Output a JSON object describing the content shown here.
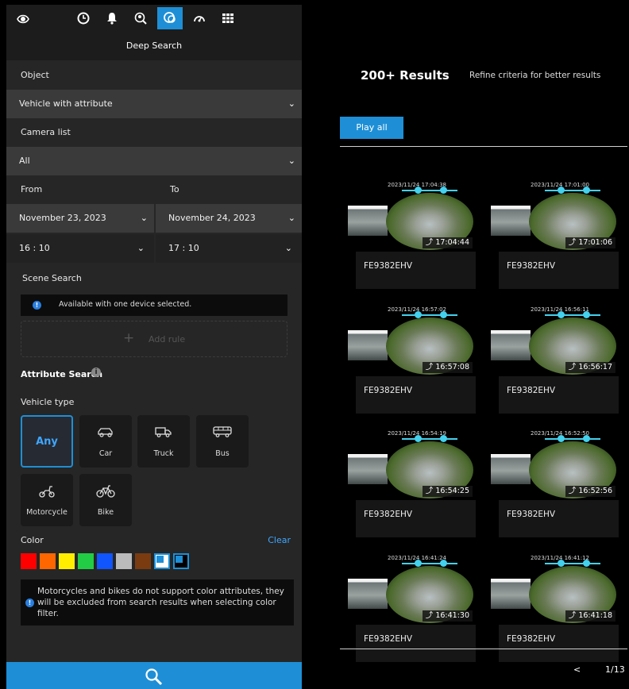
{
  "nav": {
    "icons": [
      "eye-icon",
      "clock-icon",
      "bell-icon",
      "person-search-icon",
      "deep-search-icon",
      "dashboard-icon",
      "grid-icon"
    ],
    "active": "deep-search-icon"
  },
  "panel": {
    "title": "Deep Search",
    "object_label": "Object",
    "object_value": "Vehicle with attribute",
    "camera_label": "Camera list",
    "camera_value": "All",
    "from_label": "From",
    "to_label": "To",
    "from_date": "November 23, 2023",
    "to_date": "November 24, 2023",
    "from_time": "16 : 10",
    "to_time": "17 : 10",
    "scene_label": "Scene Search",
    "scene_info": "Available with one device selected.",
    "add_rule_label": "Add rule",
    "attr_label": "Attribute Search",
    "vehicle_type_label": "Vehicle type",
    "vehicle_types": [
      {
        "label": "Any",
        "icon": "any"
      },
      {
        "label": "Car",
        "icon": "car-icon"
      },
      {
        "label": "Truck",
        "icon": "truck-icon"
      },
      {
        "label": "Bus",
        "icon": "bus-icon"
      },
      {
        "label": "Motorcycle",
        "icon": "motorcycle-icon"
      },
      {
        "label": "Bike",
        "icon": "bike-icon"
      }
    ],
    "color_label": "Color",
    "color_clear": "Clear",
    "colors": [
      "#ff0000",
      "#ff6600",
      "#ffee00",
      "#22cc44",
      "#1155ff",
      "#bbbbbb",
      "#7a3b10",
      "#ffffff",
      "#000000"
    ],
    "color_warning": "Motorcycles and bikes do not support color attributes, they will be excluded from search results when selecting color filter."
  },
  "results": {
    "count": "200+ Results",
    "hint": "Refine criteria for better results",
    "play_all": "Play all",
    "pager_prev": "<",
    "pager_text": "1/13",
    "items": [
      {
        "stamp": "2023/11/24 17:04:38",
        "time": "17:04:44",
        "camera": "FE9382EHV"
      },
      {
        "stamp": "2023/11/24 17:01:00",
        "time": "17:01:06",
        "camera": "FE9382EHV"
      },
      {
        "stamp": "2023/11/24 16:57:02",
        "time": "16:57:08",
        "camera": "FE9382EHV"
      },
      {
        "stamp": "2023/11/24 16:56:11",
        "time": "16:56:17",
        "camera": "FE9382EHV"
      },
      {
        "stamp": "2023/11/24 16:54:19",
        "time": "16:54:25",
        "camera": "FE9382EHV"
      },
      {
        "stamp": "2023/11/24 16:52:50",
        "time": "16:52:56",
        "camera": "FE9382EHV"
      },
      {
        "stamp": "2023/11/24 16:41:24",
        "time": "16:41:30",
        "camera": "FE9382EHV"
      },
      {
        "stamp": "2023/11/24 16:41:12",
        "time": "16:41:18",
        "camera": "FE9382EHV"
      }
    ]
  }
}
